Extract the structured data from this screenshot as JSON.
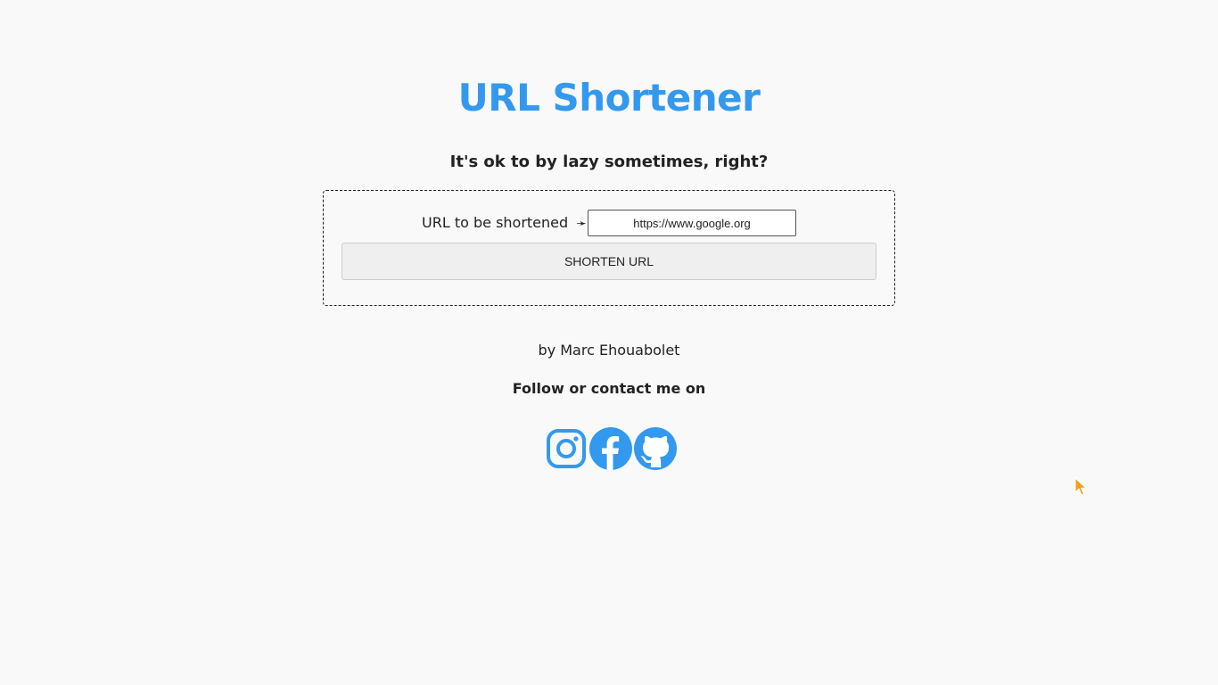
{
  "header": {
    "title": "URL Shortener",
    "subtitle": "It's ok to by lazy sometimes, right?"
  },
  "form": {
    "label": "URL to be shortened",
    "arrow": "➛",
    "input_value": "https://www.google.org",
    "button_label": "SHORTEN URL"
  },
  "footer": {
    "author": "by Marc Ehouabolet",
    "follow": "Follow or contact me on",
    "socials": [
      {
        "icon": "instagram-icon"
      },
      {
        "icon": "facebook-icon"
      },
      {
        "icon": "github-icon"
      }
    ]
  },
  "colors": {
    "accent": "#3399ee",
    "background": "#f9f9f9",
    "text": "#222222"
  }
}
